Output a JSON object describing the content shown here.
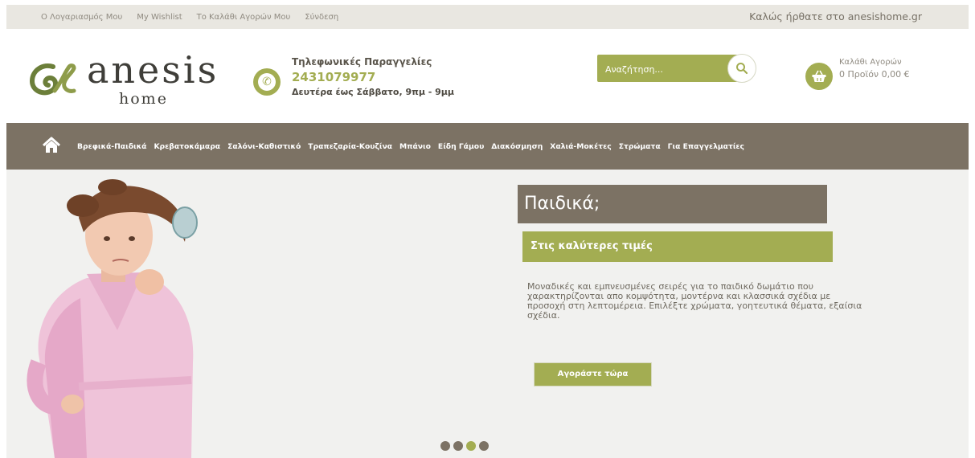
{
  "top_bar": {
    "links": [
      "Ο Λογαριασμός Μου",
      "My Wishlist",
      "Το Καλάθι Αγορών Μου",
      "Σύνδεση"
    ],
    "welcome": "Καλώς ήρθατε στο anesishome.gr"
  },
  "logo": {
    "word": "anesis",
    "sub": "home"
  },
  "phone": {
    "title": "Τηλεφωνικές Παραγγελίες",
    "number": "2431079977",
    "hours": "Δευτέρα έως Σάββατο, 9πμ - 9μμ",
    "icon": "phone-icon"
  },
  "search": {
    "placeholder": "Αναζήτηση...",
    "icon": "search-icon"
  },
  "cart": {
    "title": "Καλάθι Αγορών",
    "summary": "0 Προϊόν 0,00 €",
    "icon": "shopping-basket-icon"
  },
  "nav": {
    "home_icon": "home-icon",
    "items": [
      "Βρεφικά-Παιδικά",
      "Κρεβατοκάμαρα",
      "Σαλόνι-Καθιστικό",
      "Τραπεζαρία-Κουζίνα",
      "Μπάνιο",
      "Είδη Γάμου",
      "Διακόσμηση",
      "Χαλιά-Μοκέτες",
      "Στρώματα",
      "Για Επαγγελματίες"
    ]
  },
  "slide": {
    "title": "Παιδικά;",
    "subtitle": "Στις καλύτερες τιμές",
    "description": "Μοναδικές και εμπνευσμένες σειρές για το παιδικό δωμάτιο που χαρακτηρίζονται απο κομψότητα, μοντέρνα και κλασσικά σχέδια με προσοχή στη λεπτομέρεια. Επιλέξτε χρώματα, γοητευτικά θέματα, εξαίσια σχέδια.",
    "cta": "Αγοράστε τώρα",
    "dots": 4,
    "active_dot": 3
  },
  "colors": {
    "accent": "#a3ad52",
    "brown": "#7c7264",
    "topbar": "#e9e7e1"
  }
}
